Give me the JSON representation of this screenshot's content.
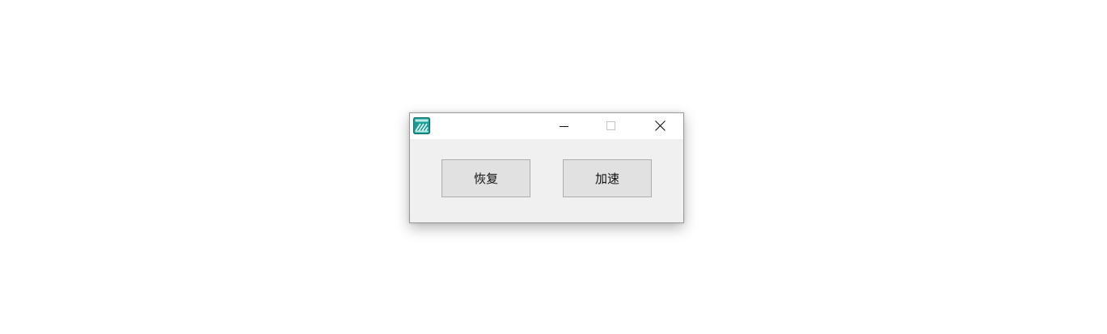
{
  "window": {
    "title": "",
    "icon": "app-stripes-icon",
    "colors": {
      "titlebar": "#ffffff",
      "client": "#f0f0f0",
      "button_face": "#e1e1e1",
      "button_border": "#adadad",
      "icon_accent": "#1a9c97"
    }
  },
  "caption": {
    "minimize_icon": "minimize-icon",
    "maximize_icon": "maximize-icon",
    "close_icon": "close-icon"
  },
  "buttons": {
    "restore_label": "恢复",
    "speedup_label": "加速"
  }
}
